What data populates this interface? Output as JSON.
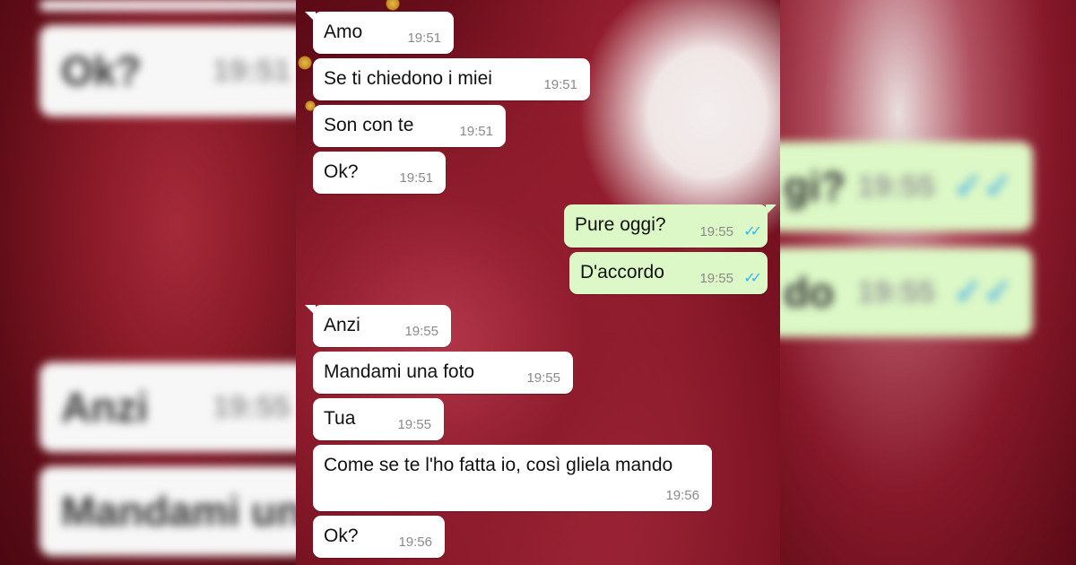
{
  "left_panel": {
    "bubble_1_text": "Ok?",
    "bubble_1_time": "19:51",
    "bubble_2_text": "Anzi",
    "bubble_2_time": "19:55",
    "bubble_3_text": "Mandami un"
  },
  "right_panel": {
    "bubble_1_text": "gi?",
    "bubble_1_time": "19:55",
    "bubble_2_text": "do",
    "bubble_2_time": "19:55"
  },
  "messages": [
    {
      "direction": "in",
      "text": "Amo",
      "time": "19:51"
    },
    {
      "direction": "in",
      "text": "Se ti chiedono i miei",
      "time": "19:51"
    },
    {
      "direction": "in",
      "text": "Son con te",
      "time": "19:51"
    },
    {
      "direction": "in",
      "text": "Ok?",
      "time": "19:51"
    },
    {
      "direction": "out",
      "text": "Pure oggi?",
      "time": "19:55",
      "status": "read"
    },
    {
      "direction": "out",
      "text": "D'accordo",
      "time": "19:55",
      "status": "read"
    },
    {
      "direction": "in",
      "text": "Anzi",
      "time": "19:55"
    },
    {
      "direction": "in",
      "text": "Mandami una foto",
      "time": "19:55"
    },
    {
      "direction": "in",
      "text": "Tua",
      "time": "19:55"
    },
    {
      "direction": "in",
      "text": "Come se te l'ho fatta io, così gliela mando",
      "time": "19:56"
    },
    {
      "direction": "in",
      "text": "Ok?",
      "time": "19:56"
    }
  ],
  "colors": {
    "incoming_bubble": "#ffffff",
    "outgoing_bubble": "#dcf8c6",
    "read_ticks": "#34b7f1",
    "background": "#7e1424"
  },
  "icons": {
    "read_receipt": "double-check-icon"
  }
}
